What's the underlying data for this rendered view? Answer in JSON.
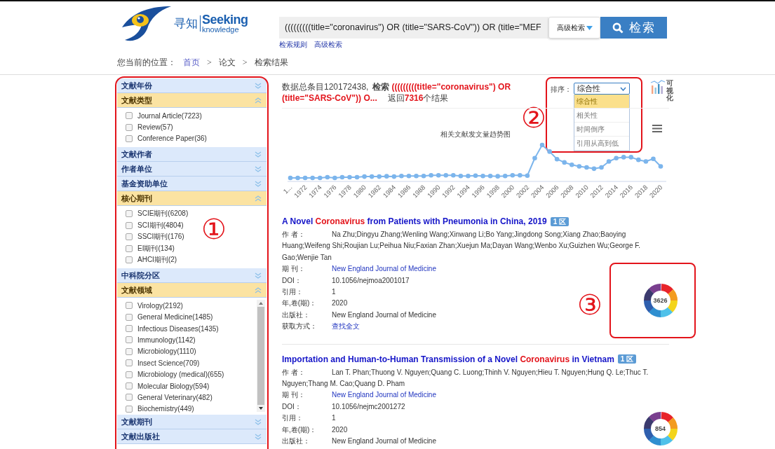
{
  "header": {
    "logo": {
      "name_cn": "寻知",
      "name_en": "Seeking",
      "tagline": "knowledge"
    },
    "search": {
      "value": "(((((((((title=\"coronavirus\") OR  (title=\"SARS-CoV\")) OR  (title=\"MEF",
      "mode": "高级检索",
      "button": "检索"
    },
    "links": [
      "检索规则",
      "高级检索"
    ]
  },
  "breadcrumb": {
    "label": "您当前的位置：",
    "items": [
      {
        "text": "首页",
        "kind": "link"
      },
      {
        "text": ">",
        "kind": "separator"
      },
      {
        "text": "论文",
        "kind": "text"
      },
      {
        "text": ">",
        "kind": "separator"
      },
      {
        "text": "检索结果",
        "kind": "text"
      }
    ]
  },
  "sidebar": {
    "annotation": "①",
    "sections": [
      {
        "title": "文献年份",
        "expanded": false
      },
      {
        "title": "文献类型",
        "expanded": true,
        "options": [
          {
            "label": "Journal Article(7223)",
            "checked": false
          },
          {
            "label": "Review(57)",
            "checked": false
          },
          {
            "label": "Conference Paper(36)",
            "checked": false
          }
        ]
      },
      {
        "title": "文献作者",
        "expanded": false
      },
      {
        "title": "作者单位",
        "expanded": false
      },
      {
        "title": "基金资助单位",
        "expanded": false
      },
      {
        "title": "核心期刊",
        "expanded": true,
        "options": [
          {
            "label": "SCIE期刊(6208)",
            "checked": false
          },
          {
            "label": "SCI期刊(4804)",
            "checked": false
          },
          {
            "label": "SSCI期刊(176)",
            "checked": false
          },
          {
            "label": "EI期刊(134)",
            "checked": false
          },
          {
            "label": "AHCI期刊(2)",
            "checked": false
          }
        ]
      },
      {
        "title": "中科院分区",
        "expanded": false
      },
      {
        "title": "文献领域",
        "expanded": true,
        "scrollable": true,
        "options": [
          {
            "label": "Virology(2192)",
            "checked": false
          },
          {
            "label": "General Medicine(1485)",
            "checked": false
          },
          {
            "label": "Infectious Diseases(1435)",
            "checked": false
          },
          {
            "label": "Immunology(1142)",
            "checked": false
          },
          {
            "label": "Microbiology(1110)",
            "checked": false
          },
          {
            "label": "Insect Science(709)",
            "checked": false
          },
          {
            "label": "Microbiology (medical)(655)",
            "checked": false
          },
          {
            "label": "Molecular Biology(594)",
            "checked": false
          },
          {
            "label": "General Veterinary(482)",
            "checked": false
          },
          {
            "label": "Biochemistry(449)",
            "checked": false
          }
        ]
      },
      {
        "title": "文献期刊",
        "expanded": false
      },
      {
        "title": "文献出版社",
        "expanded": false
      }
    ]
  },
  "results": {
    "summary": {
      "total_label": "数据总条目",
      "total": "120172438,",
      "query_label": "检索",
      "query": "(((((((((title=\"coronavirus\") OR (title=\"SARS-CoV\")) O...",
      "returned_label": "返回",
      "count": "7316",
      "count_suffix": "个结果"
    },
    "sort": {
      "label": "排序：",
      "value": "综合性",
      "expanded": true,
      "annotation": "②",
      "options": [
        {
          "label": "综合性",
          "selected": true
        },
        {
          "label": "相关性",
          "selected": false
        },
        {
          "label": "时间倒序",
          "selected": false
        },
        {
          "label": "引用从高到低",
          "selected": false
        }
      ]
    },
    "visualize_label": "可视化",
    "trend_chart": {
      "title": "相关文献发文量趋势图",
      "x_labels": [
        "1...",
        "1972",
        "1974",
        "1976",
        "1978",
        "1980",
        "1982",
        "1984",
        "1986",
        "1988",
        "1990",
        "1992",
        "1994",
        "1996",
        "1998",
        "2000",
        "2002",
        "2004",
        "2006",
        "2008",
        "2010",
        "2012",
        "2014",
        "2016",
        "2018",
        "2020"
      ]
    },
    "articles": [
      {
        "title": [
          {
            "text": "A Novel ",
            "highlight": false
          },
          {
            "text": "Coronavirus",
            "highlight": true
          },
          {
            "text": " from Patients with Pneumonia in China, 2019",
            "highlight": false
          }
        ],
        "badge": "1 区",
        "score": "3626",
        "annotation": "③",
        "fields": [
          {
            "label": "作 者：",
            "value": "Na Zhu;Dingyu Zhang;Wenling Wang;Xinwang Li;Bo Yang;Jingdong Song;Xiang Zhao;Baoying Huang;Weifeng Shi;Roujian Lu;Peihua Niu;Faxian Zhan;Xuejun Ma;Dayan Wang;Wenbo Xu;Guizhen Wu;George F. Gao;Wenjie Tan",
            "kind": "wrap"
          },
          {
            "label": "期 刊：",
            "value": "New England Journal of Medicine",
            "kind": "link"
          },
          {
            "label": "DOI：",
            "value": "10.1056/nejmoa2001017",
            "kind": "text"
          },
          {
            "label": "引用：",
            "value": "1",
            "kind": "text"
          },
          {
            "label": "年,卷(期)：",
            "value": "2020",
            "kind": "text"
          },
          {
            "label": "出版社：",
            "value": "New England Journal of Medicine",
            "kind": "text"
          },
          {
            "label": "获取方式：",
            "value": "查找全文",
            "kind": "link"
          }
        ]
      },
      {
        "title": [
          {
            "text": "Importation and Human-to-Human Transmission of a Novel ",
            "highlight": false
          },
          {
            "text": "Coronavirus",
            "highlight": true
          },
          {
            "text": " in Vietnam",
            "highlight": false
          }
        ],
        "badge": "1 区",
        "score": "854",
        "fields": [
          {
            "label": "作 者：",
            "value": "Lan T. Phan;Thuong V. Nguyen;Quang C. Luong;Thinh V. Nguyen;Hieu T. Nguyen;Hung Q. Le;Thuc T. Nguyen;Thang M. Cao;Quang D. Pham",
            "kind": "wrap"
          },
          {
            "label": "期 刊：",
            "value": "New England Journal of Medicine",
            "kind": "link"
          },
          {
            "label": "DOI：",
            "value": "10.1056/nejmc2001272",
            "kind": "text"
          },
          {
            "label": "引用：",
            "value": "1",
            "kind": "text"
          },
          {
            "label": "年,卷(期)：",
            "value": "2020",
            "kind": "text"
          },
          {
            "label": "出版社：",
            "value": "New England Journal of Medicine",
            "kind": "text"
          }
        ]
      }
    ]
  }
}
